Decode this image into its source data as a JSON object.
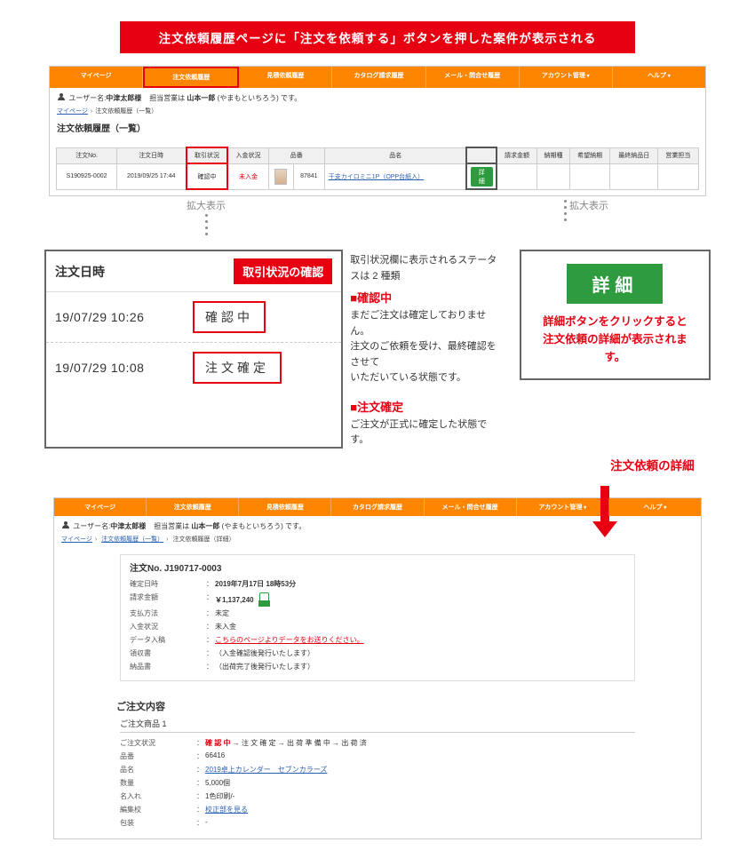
{
  "banner": "注文依頼履歴ページに「注文を依頼する」ボタンを押した案件が表示される",
  "nav": [
    "マイページ",
    "注文依頼履歴",
    "見積依頼履歴",
    "カタログ請求履歴",
    "メール・問合せ履歴",
    "アカウント管理",
    "ヘルプ"
  ],
  "user": {
    "label": "ユーザー名:",
    "name": "中津太郎様",
    "sales_label": "担当営業は",
    "sales_name": "山本一郎",
    "sales_kana": "(やまもといちろう) です。"
  },
  "breadcrumb1": {
    "a": "マイページ",
    "b": "注文依頼履歴（一覧）"
  },
  "page_title": "注文依頼履歴（一覧）",
  "table": {
    "headers": [
      "注文No.",
      "注文日時",
      "取引状況",
      "入金状況",
      "品番",
      "",
      "品名",
      "",
      "請求金額",
      "納期種",
      "希望納期",
      "最終納品日",
      "営業担当"
    ],
    "row": {
      "no": "S190925-0002",
      "date": "2019/09/25 17:44",
      "status": "確認中",
      "pay": "未入金",
      "code": "87841",
      "name": "干支カイロミニ1P（OPP台紙入）",
      "detail": "詳細"
    }
  },
  "zoom": "拡大表示",
  "status_box": {
    "header": "注文日時",
    "tag": "取引状況の確認",
    "intro": "取引状況欄に表示されるステータスは 2 種類",
    "r1_time": "19/07/29 10:26",
    "r1_pill": "確認中",
    "r1_head": "■確認中",
    "r1_body": "まだご注文は確定しておりません。\n注文のご依頼を受け、最終確認をさせて\nいただいている状態です。",
    "r2_time": "19/07/29 10:08",
    "r2_pill": "注文確定",
    "r2_head": "■注文確定",
    "r2_body": "ご注文が正式に確定した状態です。"
  },
  "detail_box": {
    "btn": "詳細",
    "txt": "詳細ボタンをクリックすると\n注文依頼の詳細が表示されます。"
  },
  "arrow_label": "注文依頼の詳細",
  "breadcrumb2": {
    "a": "マイページ",
    "b": "注文依頼履歴（一覧）",
    "c": "注文依頼履歴（詳細）"
  },
  "order": {
    "title": "注文No. J190717-0003",
    "rows": [
      {
        "k": "確定日時",
        "v": "2019年7月17日 18時53分",
        "bold": true
      },
      {
        "k": "請求金額",
        "v": "￥1,137,240",
        "bold": true,
        "doc": true
      },
      {
        "k": "支払方法",
        "v": "未定",
        "red": true
      },
      {
        "k": "入金状況",
        "v": "未入金",
        "red": true
      },
      {
        "k": "データ入稿",
        "v": "こちらのページよりデータをお送りください。",
        "red": true,
        "link": true
      },
      {
        "k": "領収書",
        "v": "（入金確認後発行いたします）"
      },
      {
        "k": "納品書",
        "v": "（出荷完了後発行いたします）"
      }
    ]
  },
  "order_content": {
    "title": "ご注文内容",
    "sub": "ご注文商品 1",
    "rows": [
      {
        "k": "ご注文状況",
        "v": "確 認 中 → 注 文 確 定 → 出 荷 準 備 中 → 出 荷 済",
        "redlead": "確 認 中"
      },
      {
        "k": "品番",
        "v": "66416"
      },
      {
        "k": "品名",
        "v": "2019卓上カレンダー　セブンカラーズ",
        "link": true
      },
      {
        "k": "数量",
        "v": "5,000個"
      },
      {
        "k": "名入れ",
        "v": "1色印刷/-"
      },
      {
        "k": "編集校",
        "v": "校正部を見る",
        "link": true
      },
      {
        "k": "包装",
        "v": "-"
      }
    ]
  }
}
